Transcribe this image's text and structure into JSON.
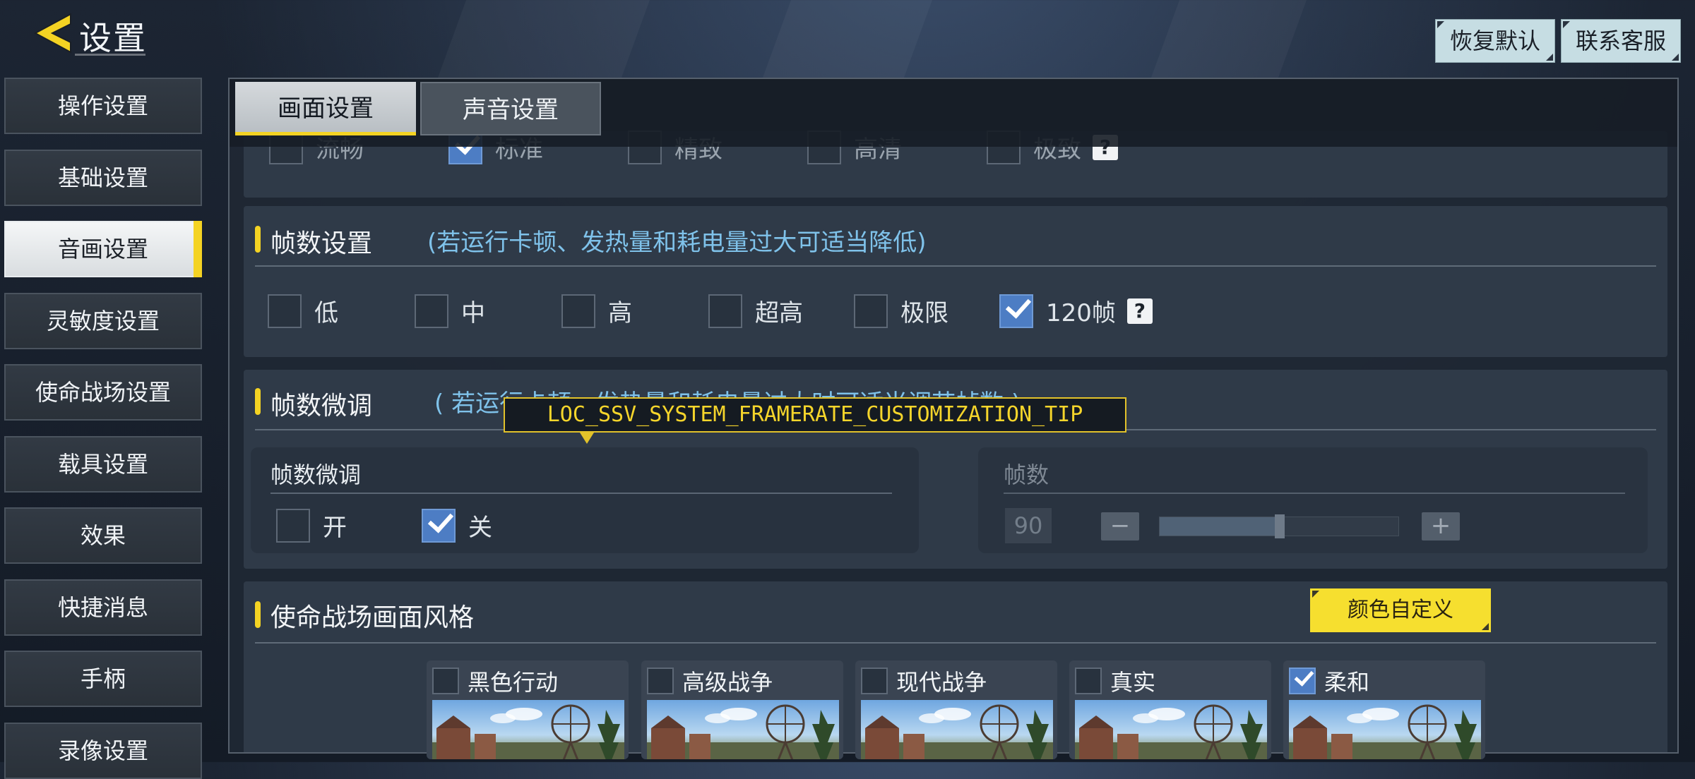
{
  "header": {
    "title": "设置",
    "restore_default": "恢复默认",
    "contact_support": "联系客服"
  },
  "sidebar": {
    "items": [
      {
        "label": "操作设置",
        "active": false
      },
      {
        "label": "基础设置",
        "active": false
      },
      {
        "label": "音画设置",
        "active": true
      },
      {
        "label": "灵敏度设置",
        "active": false
      },
      {
        "label": "使命战场设置",
        "active": false
      },
      {
        "label": "载具设置",
        "active": false
      },
      {
        "label": "效果",
        "active": false
      },
      {
        "label": "快捷消息",
        "active": false
      },
      {
        "label": "手柄",
        "active": false
      },
      {
        "label": "录像设置",
        "active": false
      }
    ]
  },
  "tabs": [
    {
      "label": "画面设置",
      "active": true
    },
    {
      "label": "声音设置",
      "active": false
    }
  ],
  "quality_row": {
    "options": [
      {
        "label": "流畅",
        "checked": false
      },
      {
        "label": "标准",
        "checked": true
      },
      {
        "label": "精致",
        "checked": false
      },
      {
        "label": "高清",
        "checked": false
      },
      {
        "label": "极致",
        "checked": false
      }
    ],
    "help": "?"
  },
  "framerate": {
    "title": "帧数设置",
    "hint": "(若运行卡顿、发热量和耗电量过大可适当降低)",
    "options": [
      {
        "label": "低",
        "checked": false
      },
      {
        "label": "中",
        "checked": false
      },
      {
        "label": "高",
        "checked": false
      },
      {
        "label": "超高",
        "checked": false
      },
      {
        "label": "极限",
        "checked": false
      },
      {
        "label": "120帧",
        "checked": true
      }
    ],
    "help": "?"
  },
  "fine_tune": {
    "title": "帧数微调",
    "hint": "( 若运行卡顿、发热量和耗电量过大时可适当调节帧数 )",
    "tooltip": "LOC_SSV_SYSTEM_FRAMERATE_CUSTOMIZATION_TIP",
    "toggle_panel": {
      "title": "帧数微调",
      "on_label": "开",
      "off_label": "关",
      "on_checked": false,
      "off_checked": true
    },
    "fps_panel": {
      "title": "帧数",
      "value": "90",
      "minus": "−",
      "plus": "+",
      "slider_fraction": 0.5
    }
  },
  "style": {
    "title": "使命战场画面风格",
    "color_button": "颜色自定义",
    "cards": [
      {
        "label": "黑色行动",
        "checked": false
      },
      {
        "label": "高级战争",
        "checked": false
      },
      {
        "label": "现代战争",
        "checked": false
      },
      {
        "label": "真实",
        "checked": false
      },
      {
        "label": "柔和",
        "checked": true
      }
    ]
  },
  "colors": {
    "accent_yellow": "#f4d323",
    "link_blue": "#7fc2ea",
    "checkbox_blue": "#4d7dc4"
  }
}
